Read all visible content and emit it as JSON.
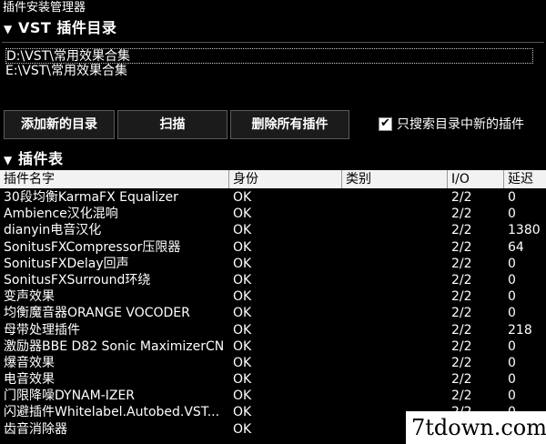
{
  "window": {
    "title": "插件安装管理器"
  },
  "vst_section": {
    "title": "VST 插件目录",
    "paths": [
      "D:\\VST\\常用效果合集",
      "E:\\VST\\常用效果合集"
    ],
    "buttons": {
      "add": "添加新的目录",
      "scan": "扫描",
      "delete_all": "删除所有插件"
    },
    "checkbox": {
      "label": "只搜索目录中新的插件",
      "checked": true
    }
  },
  "table_section": {
    "title": "插件表",
    "columns": [
      "插件名字",
      "身份",
      "类别",
      "I/O",
      "延迟"
    ],
    "rows": [
      [
        "30段均衡KarmaFX Equalizer",
        "OK",
        "",
        "2/2",
        "0"
      ],
      [
        "Ambience汉化混响",
        "OK",
        "",
        "2/2",
        "0"
      ],
      [
        "dianyin电音汉化",
        "OK",
        "",
        "2/2",
        "1380"
      ],
      [
        "SonitusFXCompressor压限器",
        "OK",
        "",
        "2/2",
        "64"
      ],
      [
        "SonitusFXDelay回声",
        "OK",
        "",
        "2/2",
        "0"
      ],
      [
        "SonitusFXSurround环绕",
        "OK",
        "",
        "2/2",
        "0"
      ],
      [
        "变声效果",
        "OK",
        "",
        "2/2",
        "0"
      ],
      [
        "均衡魔音器ORANGE VOCODER",
        "OK",
        "",
        "2/2",
        "0"
      ],
      [
        "母带处理插件",
        "OK",
        "",
        "2/2",
        "218"
      ],
      [
        "激励器BBE D82 Sonic MaximizerCN",
        "OK",
        "",
        "2/2",
        "0"
      ],
      [
        "爆音效果",
        "OK",
        "",
        "2/2",
        "0"
      ],
      [
        "电音效果",
        "OK",
        "",
        "2/2",
        "0"
      ],
      [
        "门限降噪DYNAM-IZER",
        "OK",
        "",
        "2/2",
        "0"
      ],
      [
        "闪避插件Whitelabel.Autobed.VST...",
        "OK",
        "",
        "2/2",
        "0"
      ],
      [
        "齿音消除器",
        "OK",
        "",
        "",
        ""
      ]
    ]
  },
  "watermark": "7tdown.com"
}
